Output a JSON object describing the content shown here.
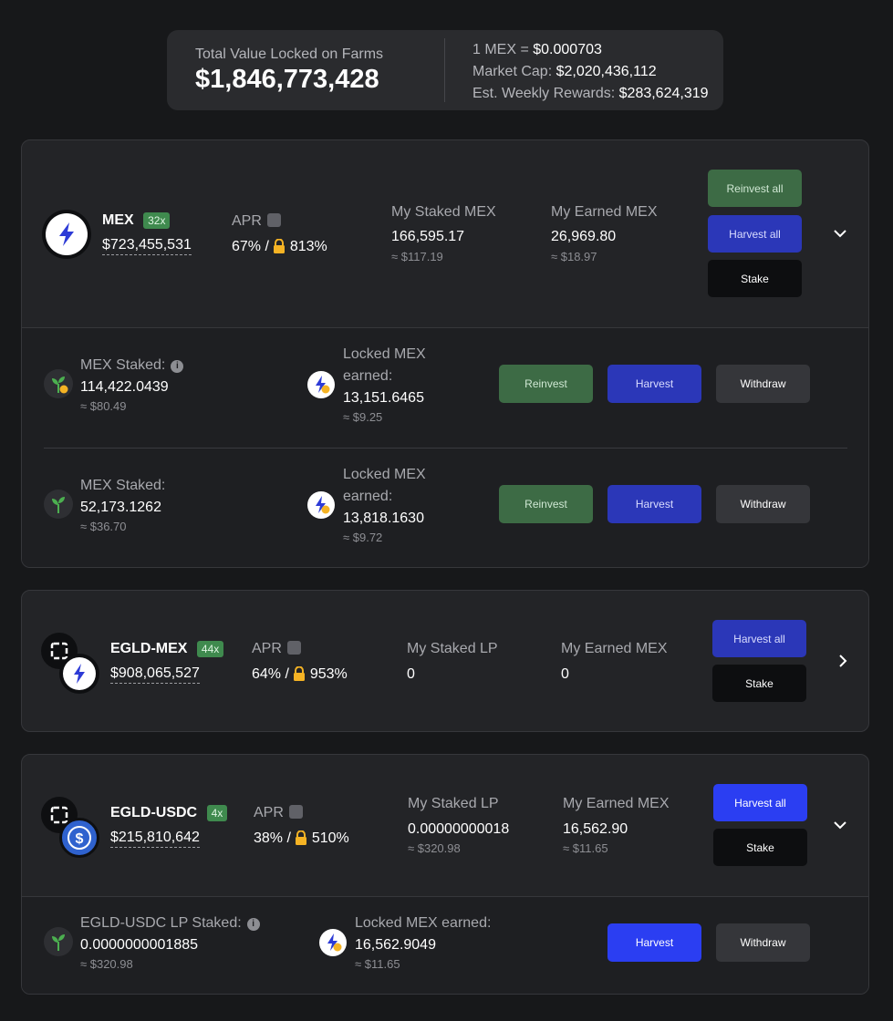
{
  "summary": {
    "tvl_label": "Total Value Locked on Farms",
    "tvl_value": "$1,846,773,428",
    "price_label": "1 MEX = ",
    "price_value": "$0.000703",
    "mcap_label": "Market Cap: ",
    "mcap_value": "$2,020,436,112",
    "rewards_label": "Est. Weekly Rewards: ",
    "rewards_value": "$283,624,319"
  },
  "farms": [
    {
      "name": "MEX",
      "multiplier": "32x",
      "liquidity": "$723,455,531",
      "apr_label": "APR",
      "apr_value": "67%",
      "apr_sep": "/",
      "apr_locked": "813%",
      "staked_label": "My Staked MEX",
      "staked_value": "166,595.17",
      "staked_usd": "≈ $117.19",
      "earned_label": "My Earned MEX",
      "earned_value": "26,969.80",
      "earned_usd": "≈ $18.97",
      "buttons": {
        "reinvest_all": "Reinvest all",
        "harvest_all": "Harvest all",
        "stake": "Stake"
      },
      "positions": [
        {
          "staked_label": "MEX Staked:",
          "staked_value": "114,422.0439",
          "staked_usd": "≈ $80.49",
          "earned_label_1": "Locked MEX",
          "earned_label_2": "earned:",
          "earned_value": "13,151.6465",
          "earned_usd": "≈ $9.25",
          "reinvest": "Reinvest",
          "harvest": "Harvest",
          "withdraw": "Withdraw"
        },
        {
          "staked_label": "MEX Staked:",
          "staked_value": "52,173.1262",
          "staked_usd": "≈ $36.70",
          "earned_label_1": "Locked MEX",
          "earned_label_2": "earned:",
          "earned_value": "13,818.1630",
          "earned_usd": "≈ $9.72",
          "reinvest": "Reinvest",
          "harvest": "Harvest",
          "withdraw": "Withdraw"
        }
      ]
    },
    {
      "name": "EGLD-MEX",
      "multiplier": "44x",
      "liquidity": "$908,065,527",
      "apr_label": "APR",
      "apr_value": "64%",
      "apr_sep": "/",
      "apr_locked": "953%",
      "staked_label": "My Staked LP",
      "staked_value": "0",
      "earned_label": "My Earned MEX",
      "earned_value": "0",
      "buttons": {
        "harvest_all": "Harvest all",
        "stake": "Stake"
      }
    },
    {
      "name": "EGLD-USDC",
      "multiplier": "4x",
      "liquidity": "$215,810,642",
      "apr_label": "APR",
      "apr_value": "38%",
      "apr_sep": "/",
      "apr_locked": "510%",
      "staked_label": "My Staked LP",
      "staked_value": "0.00000000018",
      "staked_usd": "≈ $320.98",
      "earned_label": "My Earned MEX",
      "earned_value": "16,562.90",
      "earned_usd": "≈ $11.65",
      "buttons": {
        "harvest_all": "Harvest all",
        "stake": "Stake"
      },
      "positions": [
        {
          "staked_label": "EGLD-USDC LP Staked:",
          "staked_value": "0.0000000001885",
          "staked_usd": "≈ $320.98",
          "earned_label": "Locked MEX earned:",
          "earned_value": "16,562.9049",
          "earned_usd": "≈ $11.65",
          "harvest": "Harvest",
          "withdraw": "Withdraw"
        }
      ]
    }
  ],
  "colors": {
    "background": "#17181a",
    "card": "#232427",
    "green_button": "#3d6b45",
    "blue_button": "#2b37b8",
    "bright_blue_button": "#2b3ef2",
    "multiplier_badge": "#3f8a4e",
    "lock_icon": "#f5b324"
  },
  "icons": {
    "mex_token": "lightning-bolt-icon",
    "egld_token": "egld-icon",
    "usdc_token": "usdc-dollar-icon",
    "position_sprout": "sprout-icon",
    "locked_mex": "locked-mex-icon",
    "apr_calculator": "calculator-icon",
    "lock": "lock-icon",
    "info": "info-icon",
    "expand": "chevron-down-icon",
    "collapse": "chevron-right-icon"
  }
}
